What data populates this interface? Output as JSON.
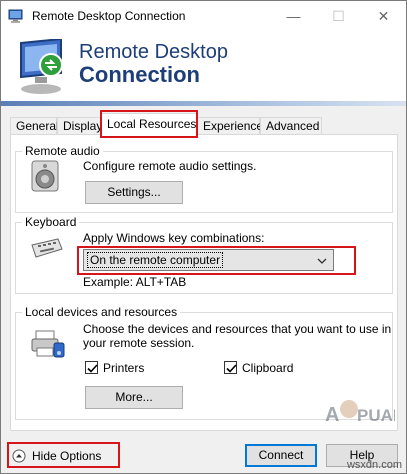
{
  "window": {
    "title": "Remote Desktop Connection",
    "controls": {
      "minimize": "—",
      "maximize": "☐",
      "close": "✕"
    }
  },
  "banner": {
    "line1": "Remote Desktop",
    "line2": "Connection"
  },
  "tabs": [
    {
      "label": "General"
    },
    {
      "label": "Display"
    },
    {
      "label": "Local Resources",
      "active": true
    },
    {
      "label": "Experience"
    },
    {
      "label": "Advanced"
    }
  ],
  "remote_audio": {
    "title": "Remote audio",
    "description": "Configure remote audio settings.",
    "settings_button": "Settings..."
  },
  "keyboard": {
    "title": "Keyboard",
    "description": "Apply Windows key combinations:",
    "selected": "On the remote computer",
    "example": "Example: ALT+TAB"
  },
  "local_devices": {
    "title": "Local devices and resources",
    "description_line1": "Choose the devices and resources that you want to use in",
    "description_line2": "your remote session.",
    "printers": {
      "label": "Printers",
      "checked": true
    },
    "clipboard": {
      "label": "Clipboard",
      "checked": true
    },
    "more_button": "More..."
  },
  "footer": {
    "hide_options": "Hide Options",
    "connect": "Connect",
    "help": "Help"
  },
  "watermark": {
    "text": "A PUALS",
    "site": "wsxdn.com"
  },
  "colors": {
    "highlight": "#d7141a",
    "brand_text": "#1d3e78",
    "focus": "#0078d7"
  }
}
